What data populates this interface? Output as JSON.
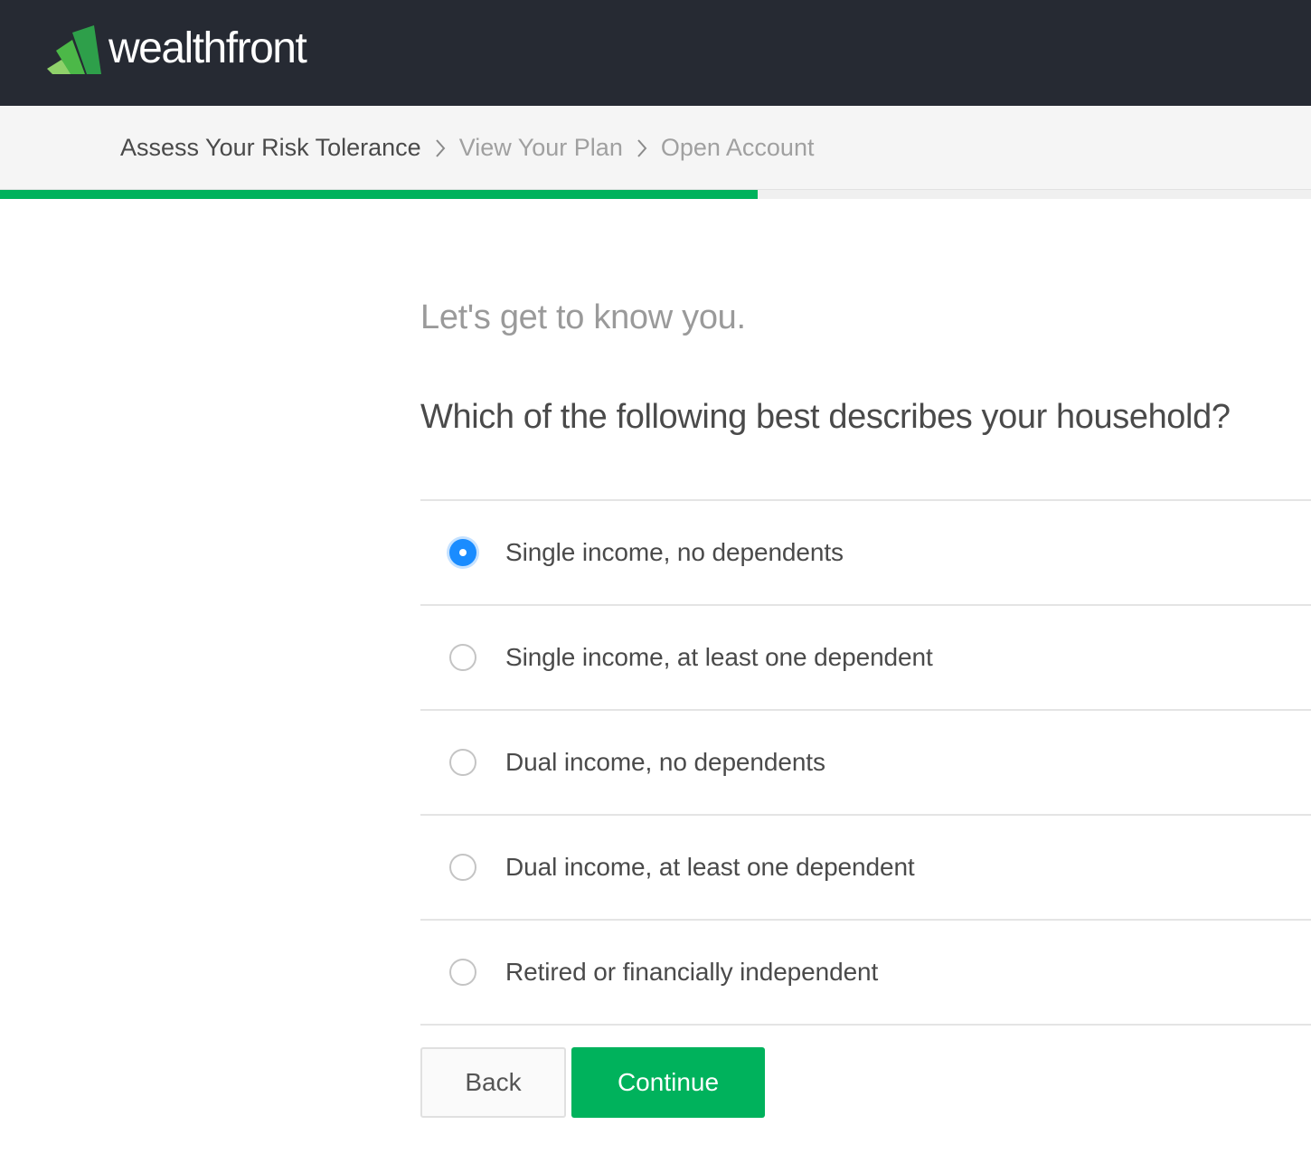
{
  "header": {
    "logo_text": "wealthfront",
    "logo_icon": "wealthfront-logo-icon",
    "background_color": "#262a33"
  },
  "steps": [
    {
      "label": "Assess Your Risk Tolerance",
      "active": true
    },
    {
      "label": "View Your Plan",
      "active": false
    },
    {
      "label": "Open Account",
      "active": false
    }
  ],
  "progress": {
    "percent": 57.8,
    "color": "#00b25c"
  },
  "form": {
    "eyebrow": "Let's get to know you.",
    "question": "Which of the following best describes your household?",
    "options": [
      {
        "label": "Single income, no dependents",
        "selected": true
      },
      {
        "label": "Single income, at least one dependent",
        "selected": false
      },
      {
        "label": "Dual income, no dependents",
        "selected": false
      },
      {
        "label": "Dual income, at least one dependent",
        "selected": false
      },
      {
        "label": "Retired or financially independent",
        "selected": false
      }
    ],
    "selected_color": "#1a8cff"
  },
  "buttons": {
    "back_label": "Back",
    "continue_label": "Continue",
    "continue_color": "#00b25c"
  }
}
